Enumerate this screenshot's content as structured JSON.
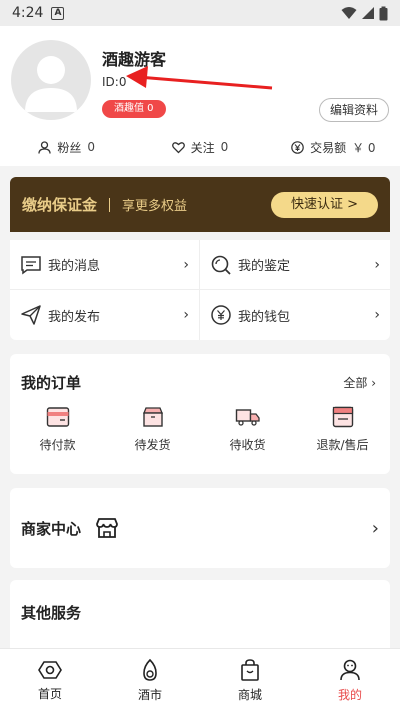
{
  "status_bar": {
    "time": "4:24",
    "notif_letter": "A"
  },
  "profile": {
    "username": "酒趣游客",
    "id_text": "ID:0",
    "wine_badge": "酒趣值 0",
    "edit_button": "编辑资料"
  },
  "stats": [
    {
      "icon": "user-icon",
      "label": "粉丝",
      "value": "0"
    },
    {
      "icon": "heart-icon",
      "label": "关注",
      "value": "0"
    },
    {
      "icon": "yen-icon",
      "label": "交易额",
      "value": "￥ 0"
    }
  ],
  "deposit": {
    "title": "缴纳保证金",
    "subtitle": "享更多权益",
    "button": "快速认证 >"
  },
  "quick_menu": [
    {
      "icon": "message-icon",
      "label": "我的消息"
    },
    {
      "icon": "magnifier-icon",
      "label": "我的鉴定"
    },
    {
      "icon": "send-icon",
      "label": "我的发布"
    },
    {
      "icon": "wallet-icon",
      "label": "我的钱包"
    }
  ],
  "orders": {
    "title": "我的订单",
    "all": "全部",
    "items": [
      {
        "icon": "pending-payment-icon",
        "label": "待付款"
      },
      {
        "icon": "pending-shipment-icon",
        "label": "待发货"
      },
      {
        "icon": "delivery-truck-icon",
        "label": "待收货"
      },
      {
        "icon": "refund-icon",
        "label": "退款/售后"
      }
    ]
  },
  "merchant": {
    "title": "商家中心"
  },
  "other_services": {
    "title": "其他服务"
  },
  "tabbar": [
    {
      "icon": "home-icon",
      "label": "首页",
      "active": false
    },
    {
      "icon": "wine-market-icon",
      "label": "酒市",
      "active": false
    },
    {
      "icon": "shop-bag-icon",
      "label": "商城",
      "active": false
    },
    {
      "icon": "profile-icon",
      "label": "我的",
      "active": true
    }
  ],
  "colors": {
    "accent_red": "#e84a4a",
    "deposit_bg": "#4a3518",
    "deposit_gold": "#e9cc88"
  }
}
